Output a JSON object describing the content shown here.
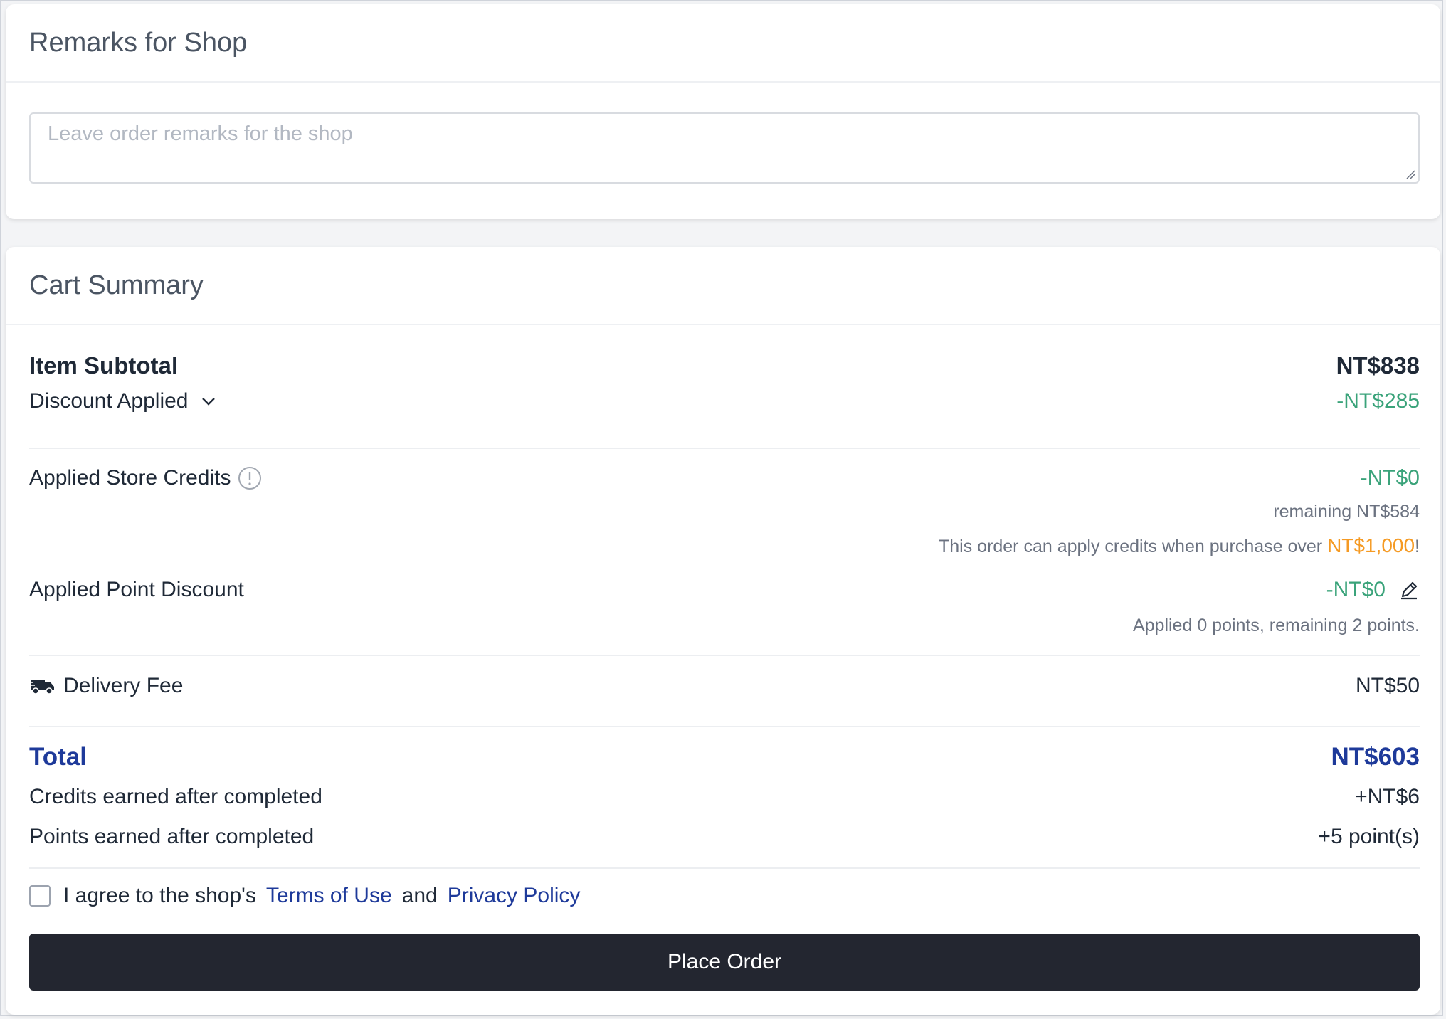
{
  "remarks": {
    "title": "Remarks for Shop",
    "placeholder": "Leave order remarks for the shop",
    "value": ""
  },
  "summary": {
    "title": "Cart Summary",
    "item_subtotal": {
      "label": "Item Subtotal",
      "value": "NT$838"
    },
    "discount": {
      "label": "Discount Applied",
      "value": "-NT$285",
      "icon": "chevron-down-icon"
    },
    "store_credits": {
      "label": "Applied Store Credits",
      "value": "-NT$0",
      "icon": "info-icon",
      "remaining": "remaining NT$584",
      "notice_prefix": "This order can apply credits when purchase over ",
      "notice_amount": "NT$1,000",
      "notice_suffix": "!"
    },
    "point_discount": {
      "label": "Applied Point Discount",
      "value": "-NT$0",
      "icon": "pencil-icon",
      "note": "Applied 0 points, remaining 2 points."
    },
    "delivery_fee": {
      "label": "Delivery Fee",
      "value": "NT$50",
      "icon": "truck-icon"
    },
    "total": {
      "label": "Total",
      "value": "NT$603"
    },
    "credits_earned": {
      "label": "Credits earned after completed",
      "value": "+NT$6"
    },
    "points_earned": {
      "label": "Points earned after completed",
      "value": "+5 point(s)"
    },
    "agreement": {
      "prefix": "I agree to the shop's",
      "terms": "Terms of Use",
      "conjunction": "and",
      "privacy": "Privacy Policy",
      "checked": false
    },
    "place_order_label": "Place Order"
  },
  "colors": {
    "accent_blue": "#1e3a9a",
    "discount_green": "#3aa37a",
    "highlight_orange": "#f59a23",
    "button_dark": "#232630"
  }
}
